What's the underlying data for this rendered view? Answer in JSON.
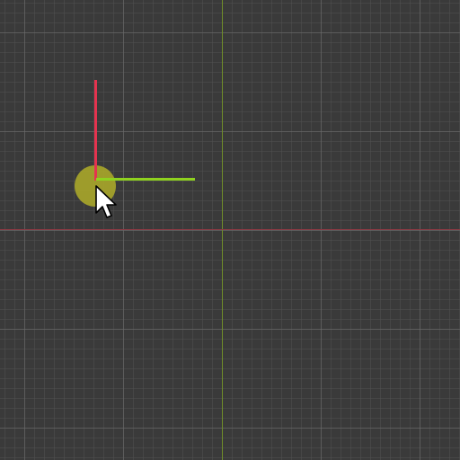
{
  "viewport": {
    "background_color": "#3a3a3a",
    "grid": {
      "major_line_color": "#6e6e6e",
      "minor_line_color": "#555555"
    },
    "world_axes": {
      "vertical_axis_color": "#6f8d2a",
      "horizontal_axis_color": "#8a3a44"
    }
  },
  "gizmo": {
    "center_handle": {
      "icon": "move-center-handle-icon",
      "color": "#a7a52a"
    },
    "vertical_handle": {
      "icon": "move-y-arrow-icon",
      "color": "#e5334f"
    },
    "horizontal_handle": {
      "icon": "move-x-arrow-icon",
      "color": "#8fd21f"
    }
  },
  "cursor": {
    "icon": "mouse-pointer-icon"
  }
}
